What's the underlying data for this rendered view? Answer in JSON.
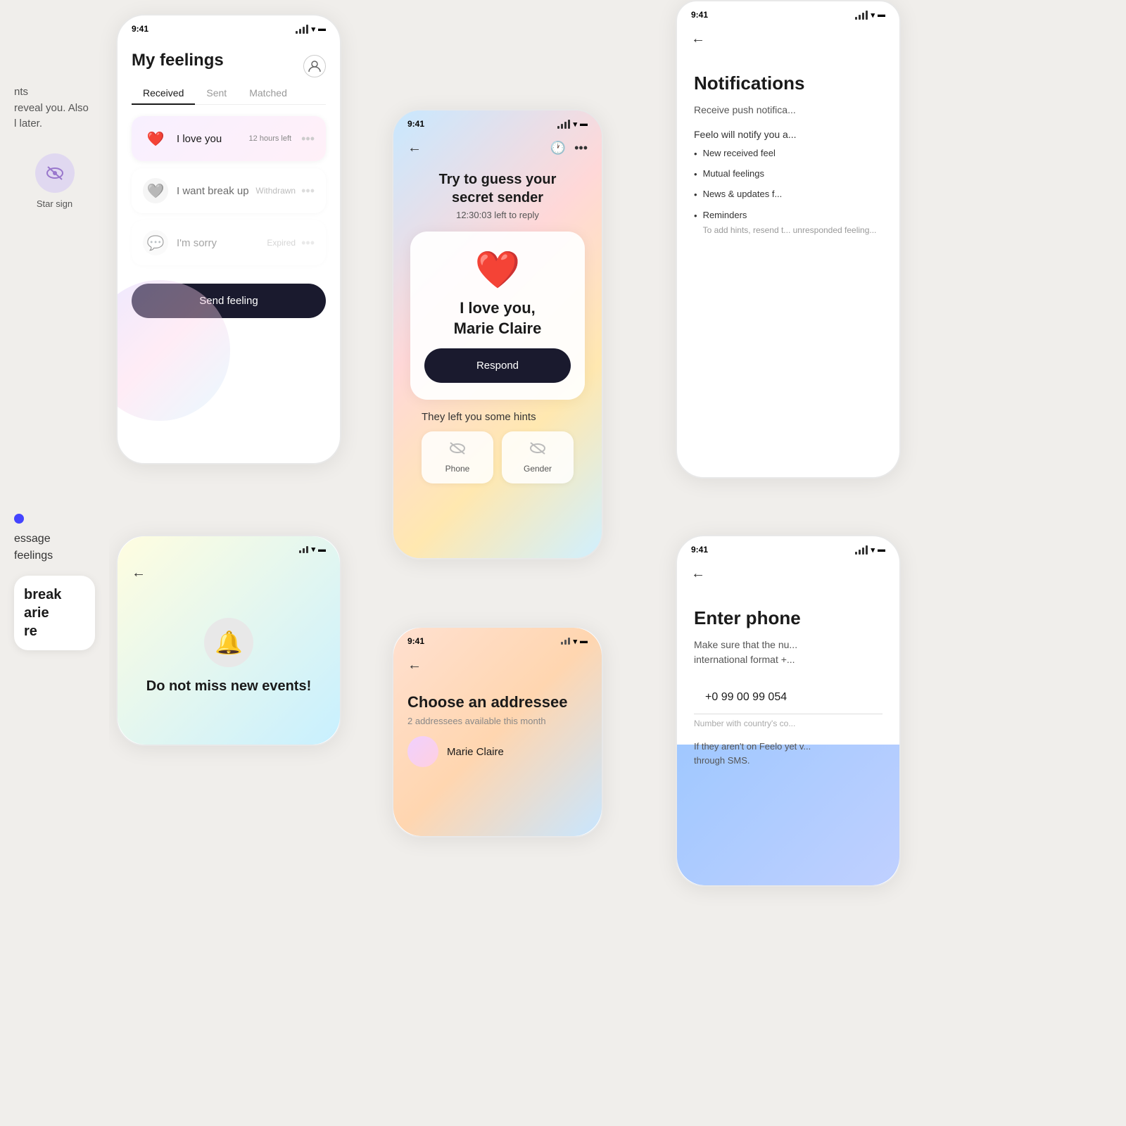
{
  "app": {
    "name": "Feelo",
    "status_time": "9:41"
  },
  "left_panel": {
    "text1": "nts",
    "text2": "reveal you. Also",
    "text3": "l later.",
    "star_sign_label": "Star sign"
  },
  "left_bottom": {
    "text1": "essage",
    "text2": "feelings",
    "break_title": "break\narie\nre"
  },
  "phone1": {
    "title": "My feelings",
    "tabs": [
      "Received",
      "Sent",
      "Matched"
    ],
    "active_tab": "Received",
    "feelings": [
      {
        "icon": "❤️",
        "text": "I love you",
        "time_left": "12 hours left",
        "status": ""
      },
      {
        "icon": "🩶",
        "text": "I want break up",
        "time_left": "",
        "status": "Withdrawn"
      },
      {
        "icon": "💬",
        "text": "I'm sorry",
        "time_left": "",
        "status": "Expired"
      }
    ],
    "send_button": "Send feeling"
  },
  "phone2": {
    "title": "Try to guess your\nsecret sender",
    "timer": "12:30:03 left to reply",
    "message": "I love you,\nMarie Claire",
    "respond_button": "Respond",
    "hints_title": "They left you some hints",
    "hints": [
      {
        "label": "Phone"
      },
      {
        "label": "Gender"
      }
    ]
  },
  "phone3": {
    "title": "Notifications",
    "subtitle": "Receive push notifica...",
    "intro": "Feelo will notify you a...",
    "items": [
      {
        "text": "New received feel"
      },
      {
        "text": "Mutual feelings"
      },
      {
        "text": "News & updates f..."
      },
      {
        "text": "Reminders",
        "sub": "To add hints, resend t...\nunresponded feeling..."
      }
    ]
  },
  "phone4": {
    "bell_label": "🔔",
    "title": "Do not miss new events!"
  },
  "phone5": {
    "title": "Choose an addressee",
    "subtitle": "2 addressees available this month",
    "addressee": "Marie Claire"
  },
  "phone6": {
    "title": "Enter phone",
    "subtitle": "Make sure that the nu...\ninternational format +...",
    "input_value": "+0 99 00 99 054",
    "input_hint": "Number with country's co...",
    "disclaimer": "If they aren't on Feelo yet v...\nthrough SMS."
  }
}
